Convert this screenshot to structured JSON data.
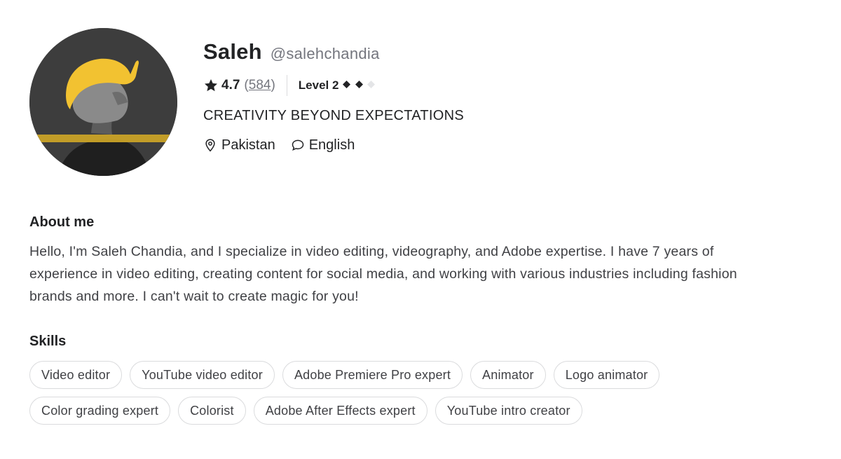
{
  "profile": {
    "display_name": "Saleh",
    "username": "@salehchandia",
    "rating": "4.7",
    "reviews_open": "(",
    "reviews_count": "584",
    "reviews_close": ")",
    "level_label": "Level 2",
    "level_value": 2,
    "level_max": 3,
    "tagline": "CREATIVITY BEYOND EXPECTATIONS",
    "location": "Pakistan",
    "language": "English",
    "avatar_colors": {
      "background": "#3a3a3a",
      "cap": "#f2c231",
      "stripe": "#c9a227"
    }
  },
  "about": {
    "title": "About me",
    "text": "Hello, I'm Saleh Chandia, and I specialize in video editing, videography, and Adobe expertise. I have 7 years of experience in video editing, creating content for social media, and working with various industries including fashion brands and more. I can't wait to create magic for you!"
  },
  "skills": {
    "title": "Skills",
    "items": [
      "Video editor",
      "YouTube video editor",
      "Adobe Premiere Pro expert",
      "Animator",
      "Logo animator",
      "Color grading expert",
      "Colorist",
      "Adobe After Effects expert",
      "YouTube intro creator"
    ]
  },
  "icons": {
    "rating": "star-icon",
    "level": "diamond-icon",
    "location": "map-pin-icon",
    "language": "speech-bubble-icon"
  }
}
